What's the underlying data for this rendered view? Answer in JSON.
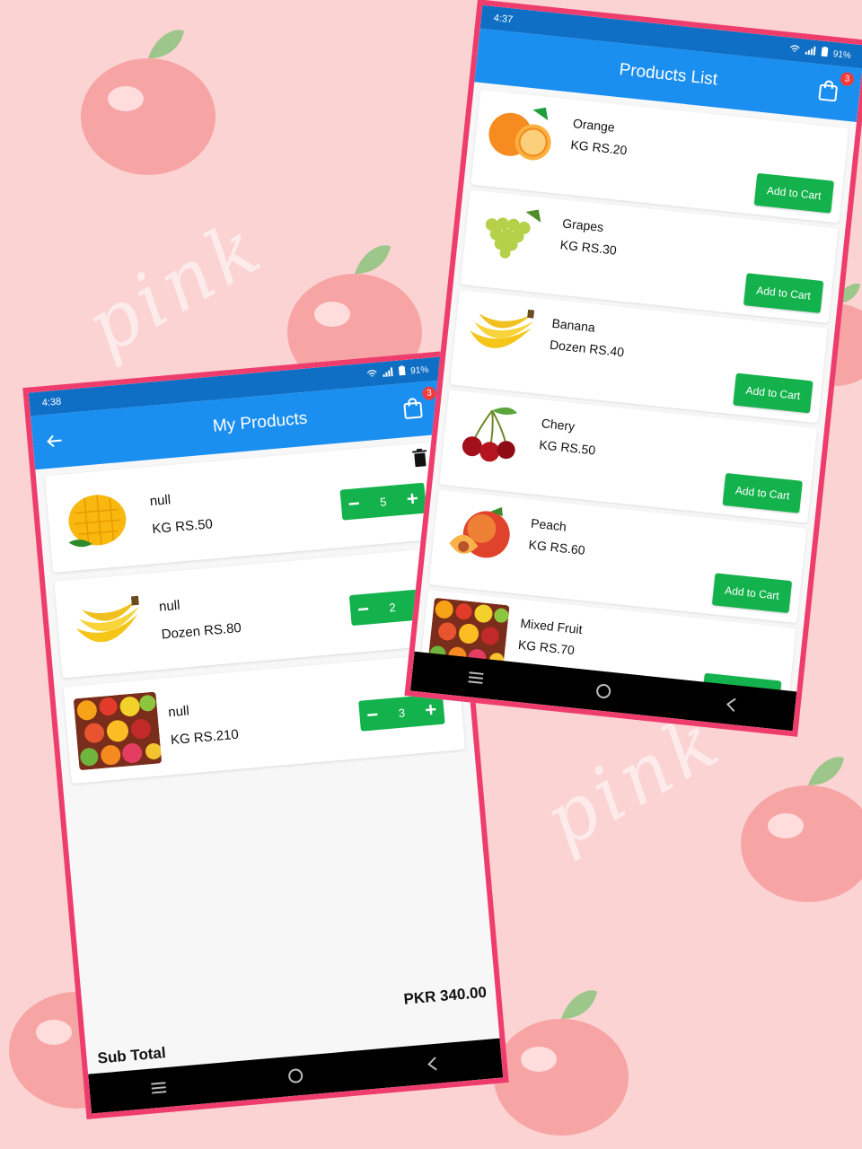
{
  "colors": {
    "background": "#fbd3d3",
    "frame": "#ee3d6d",
    "appbar": "#1b8ff0",
    "statusbar": "#0f6fc4",
    "accent_green": "#14b24c",
    "badge_red": "#f23a3a"
  },
  "decor": {
    "word": "pink"
  },
  "cart_screen": {
    "status": {
      "time": "4:38",
      "battery": "91%"
    },
    "appbar": {
      "title": "My Products",
      "back_icon": "arrow-left-icon",
      "cart_icon": "shopping-bag-icon",
      "cart_badge": "3"
    },
    "items": [
      {
        "name": "null",
        "price": "KG RS.50",
        "quantity": "5",
        "image": "mango"
      },
      {
        "name": "null",
        "price": "Dozen RS.80",
        "quantity": "2",
        "image": "banana"
      },
      {
        "name": "null",
        "price": "KG RS.210",
        "quantity": "3",
        "image": "mixed-fruit"
      }
    ],
    "stepper": {
      "minus": "−",
      "plus": "+"
    },
    "subtotal": {
      "label": "Sub Total",
      "value": "PKR 340.00"
    }
  },
  "product_screen": {
    "status": {
      "time": "4:37",
      "battery": "91%"
    },
    "appbar": {
      "title": "Products List",
      "cart_icon": "shopping-bag-icon",
      "cart_badge": "3"
    },
    "add_label": "Add to Cart",
    "items": [
      {
        "name": "Orange",
        "price": "KG RS.20",
        "image": "orange"
      },
      {
        "name": "Grapes",
        "price": "KG RS.30",
        "image": "grapes"
      },
      {
        "name": "Banana",
        "price": "Dozen RS.40",
        "image": "banana"
      },
      {
        "name": "Chery",
        "price": "KG RS.50",
        "image": "cherry"
      },
      {
        "name": "Peach",
        "price": "KG RS.60",
        "image": "peach"
      },
      {
        "name": "Mixed Fruit",
        "price": "KG RS.70",
        "image": "mixed-fruit"
      }
    ]
  },
  "navbar": {
    "icons": [
      "menu-icon",
      "home-icon",
      "back-icon"
    ]
  }
}
